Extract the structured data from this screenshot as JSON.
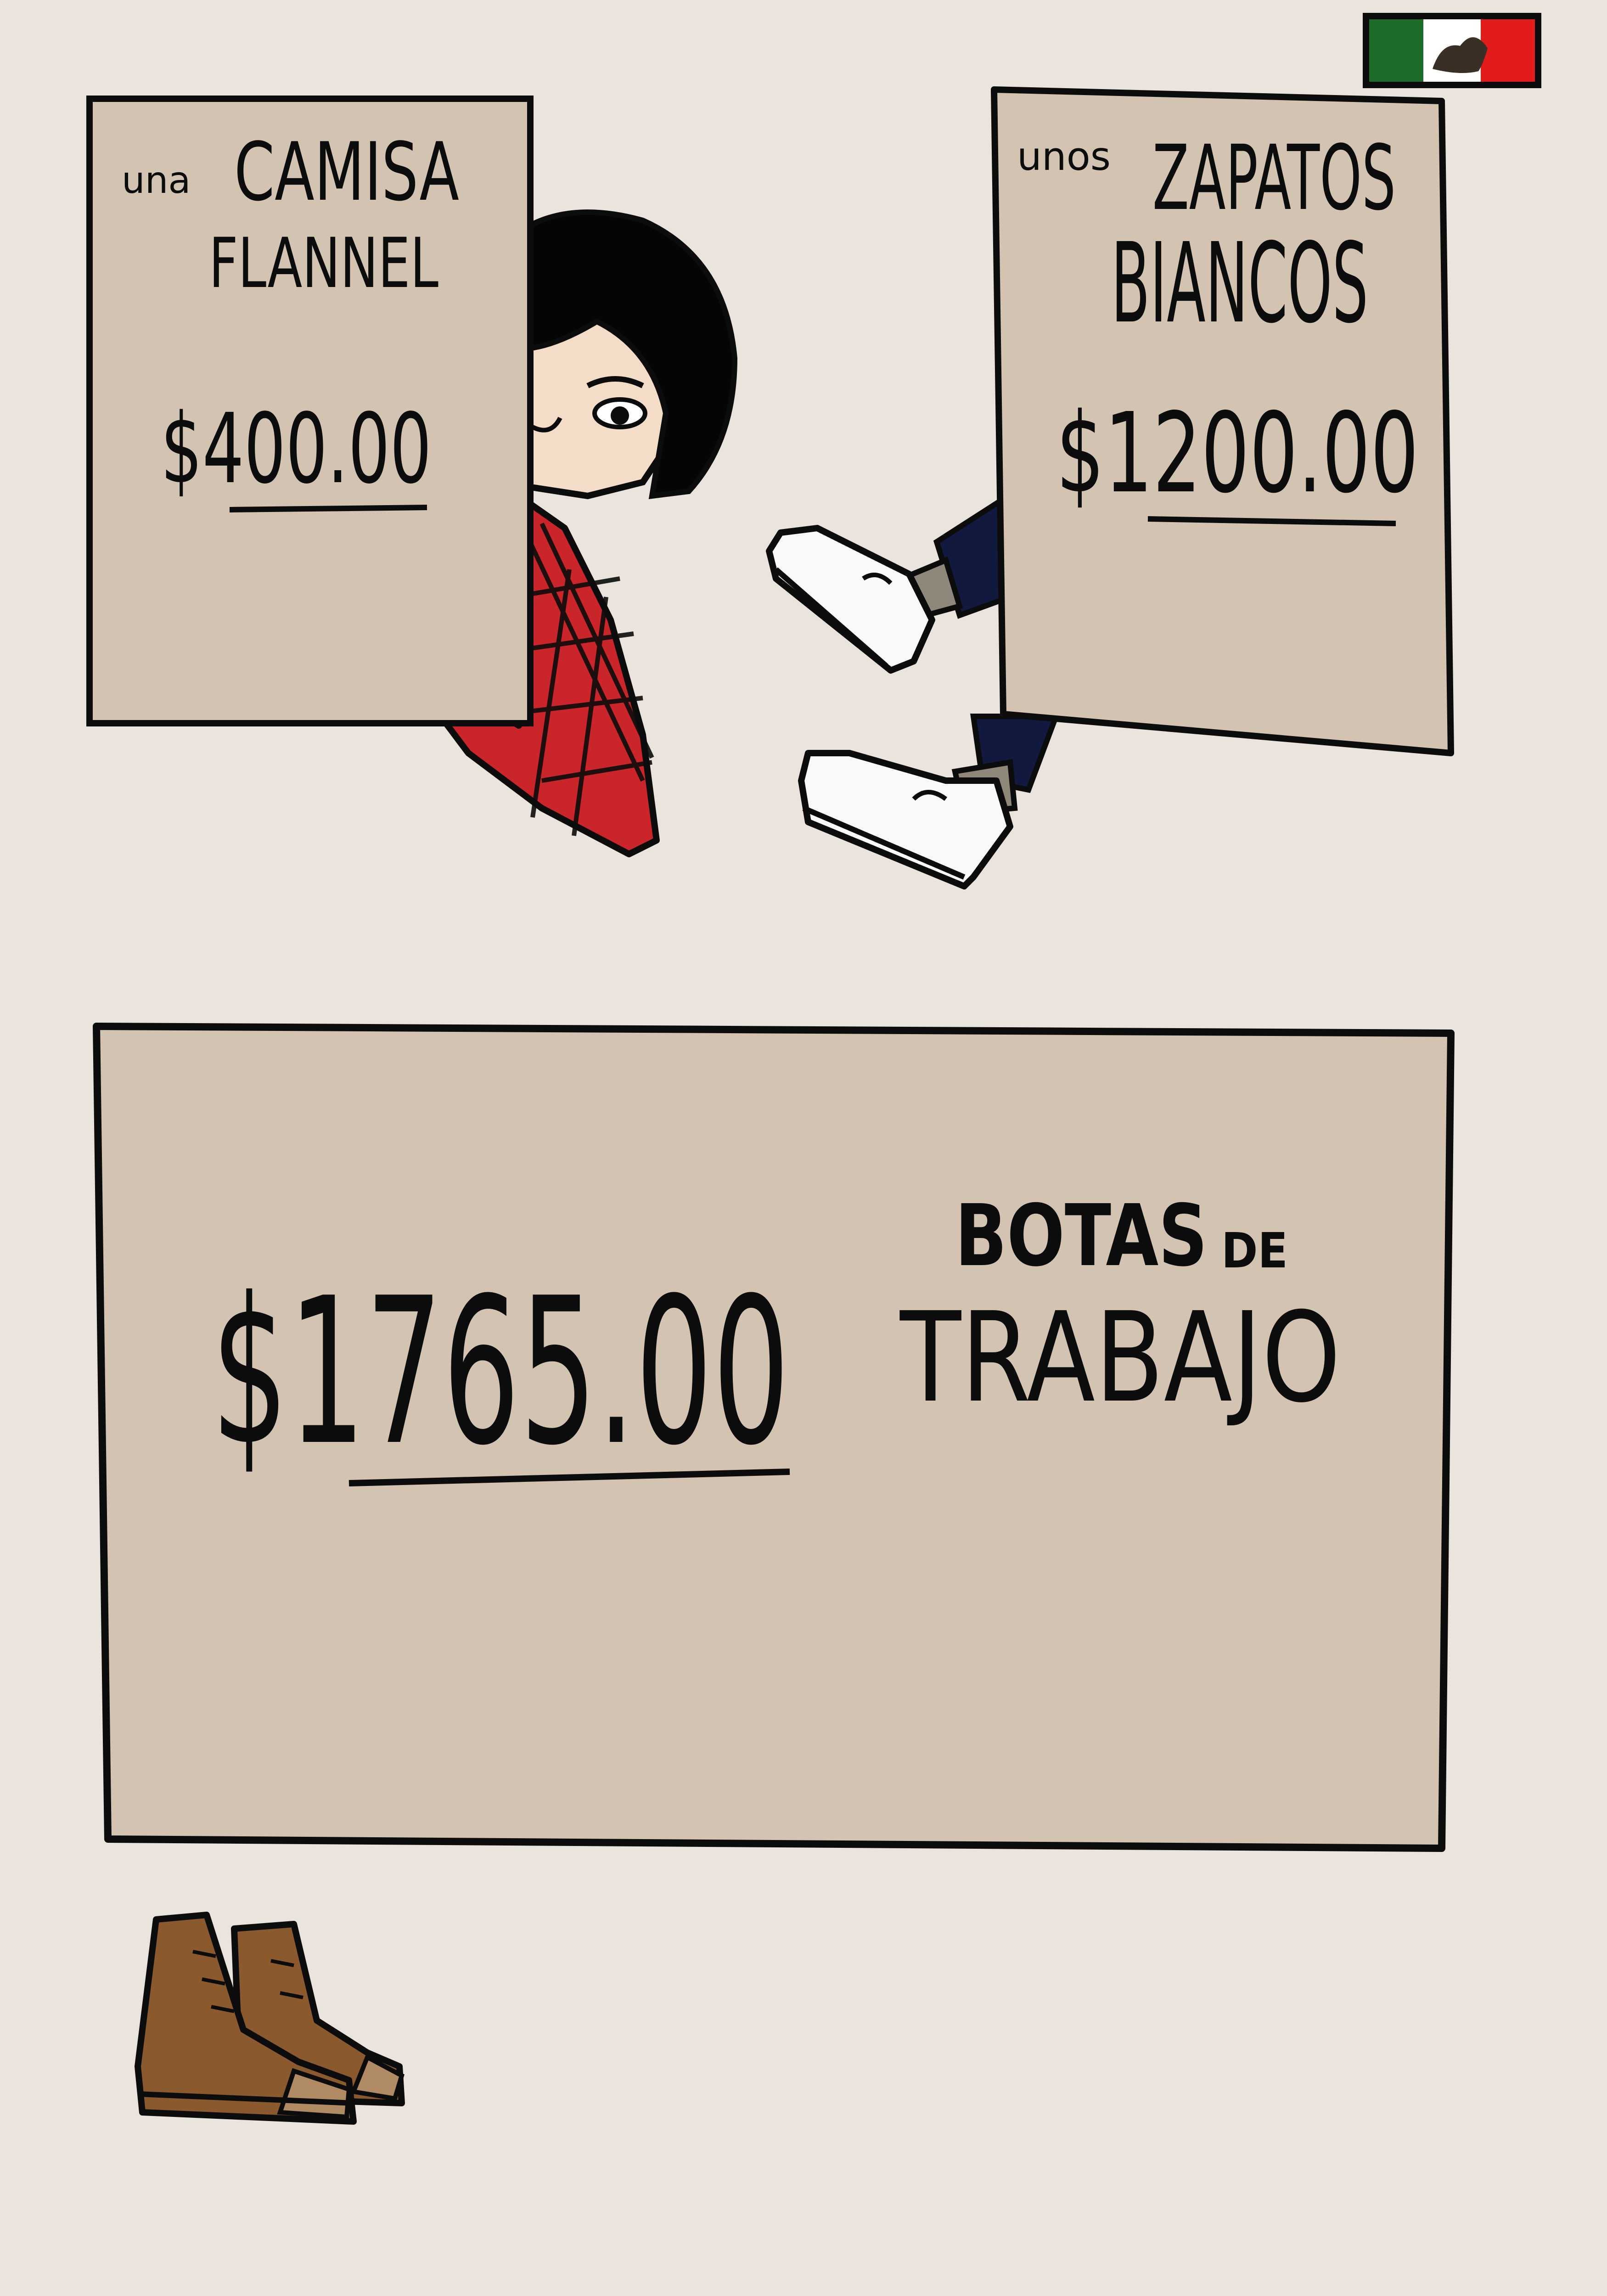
{
  "colors": {
    "background": "#eae4dd",
    "sign_fill": "#d3c3b3",
    "outline": "#0c0c0c",
    "flag_green": "#1f6b2c",
    "flag_white": "#ffffff",
    "flag_red": "#e21b1b",
    "flannel_red": "#c9252a",
    "skin": "#f3dcc8",
    "hair": "#050505",
    "boot_brown": "#8a5a2e",
    "boot_tan": "#b08a62",
    "sneaker_white": "#fafafa",
    "sock_gray": "#8f8779",
    "jeans_navy": "#111a3e"
  },
  "icons": {
    "flag": "mexico-flag-icon",
    "boots": "work-boots-icon",
    "sneakers": "white-sneakers-icon"
  },
  "signs": {
    "shirt": {
      "article": "una",
      "line1": "CAMISA",
      "line2": "FLANNEL",
      "price": "$400.00"
    },
    "shoes": {
      "article": "unos",
      "line1": "ZAPATOS",
      "line2": "BIANCOS",
      "price": "$1200.00"
    },
    "boots": {
      "price": "$1765.00",
      "line1": "BOTAS",
      "line1_suffix": "DE",
      "line2": "TRABAJO"
    }
  }
}
